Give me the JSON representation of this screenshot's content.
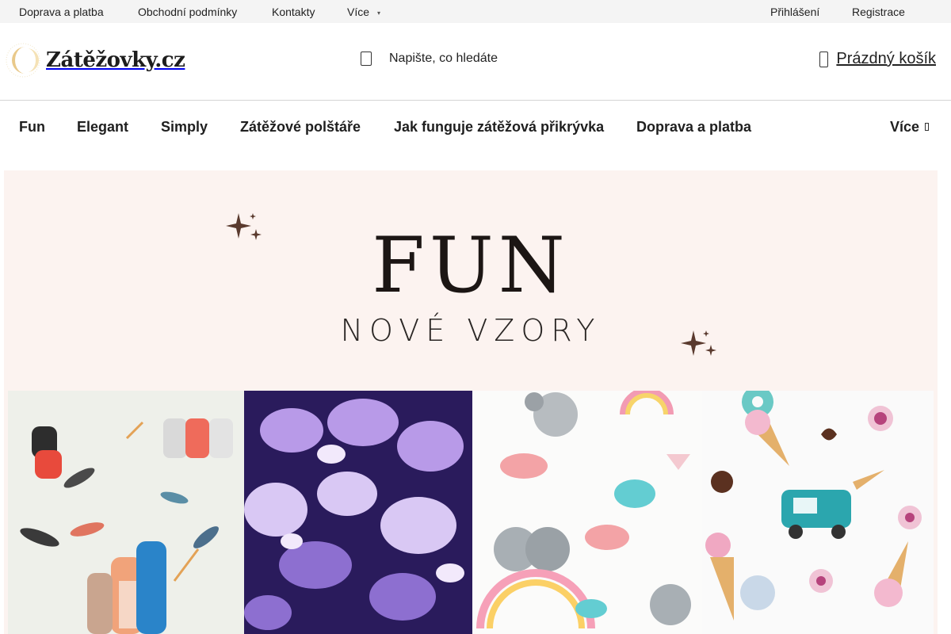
{
  "topbar": {
    "links": [
      "Doprava a platba",
      "Obchodní podmínky",
      "Kontakty",
      "Více"
    ],
    "login": "Přihlášení",
    "register": "Registrace"
  },
  "header": {
    "logo_text": "Zátěžovky.cz",
    "search_placeholder": "Napište, co hledáte",
    "cart_label": "Prázdný košík"
  },
  "nav": {
    "items": [
      "Fun",
      "Elegant",
      "Simply",
      "Zátěžové polštáře",
      "Jak funguje zátěžová přikrývka",
      "Doprava a platba"
    ],
    "more": "Více"
  },
  "hero": {
    "title": "FUN",
    "subtitle": "NOVÉ VZORY",
    "tiles": [
      "cats-fabric",
      "butterflies-fabric",
      "koalas-fabric",
      "ice-cream-fabric"
    ]
  },
  "colors": {
    "topbar_bg": "#f4f4f4",
    "hero_bg": "#fcf3f0",
    "sparkle": "#5a3a2e"
  }
}
